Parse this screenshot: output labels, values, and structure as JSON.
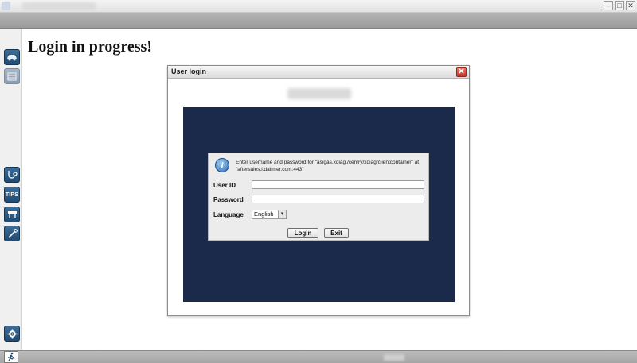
{
  "window": {
    "controls": {
      "minimize": "–",
      "maximize": "□",
      "close": "✕"
    }
  },
  "sidebar": {
    "items": [
      {
        "name": "car-icon",
        "glyph": "🚗"
      },
      {
        "name": "vehicle-list-icon",
        "glyph": "▤"
      },
      {
        "name": "stethoscope-icon",
        "glyph": "⚕"
      },
      {
        "name": "tips-icon",
        "label": "TIPS"
      },
      {
        "name": "lift-icon",
        "glyph": "⊞"
      },
      {
        "name": "tools-icon",
        "glyph": "✎"
      },
      {
        "name": "settings-icon",
        "glyph": "⚙"
      }
    ]
  },
  "page": {
    "title": "Login in progress!"
  },
  "dialog": {
    "title": "User login",
    "close_label": "✕",
    "message": "Enter username and password for \"asigas.xdiag./centry/xdiag/clientcontainer\" at \"aftersales.i.daimler.com:443\"",
    "fields": {
      "user_id_label": "User ID",
      "user_id_value": "",
      "password_label": "Password",
      "password_value": "",
      "language_label": "Language",
      "language_value": "English"
    },
    "buttons": {
      "login": "Login",
      "exit": "Exit"
    }
  },
  "statusbar": {
    "run_glyph": "🏃"
  },
  "colors": {
    "panel_bg": "#1b2a4a",
    "sidebar_btn": "#1f4a73",
    "close_btn": "#c0392b"
  }
}
